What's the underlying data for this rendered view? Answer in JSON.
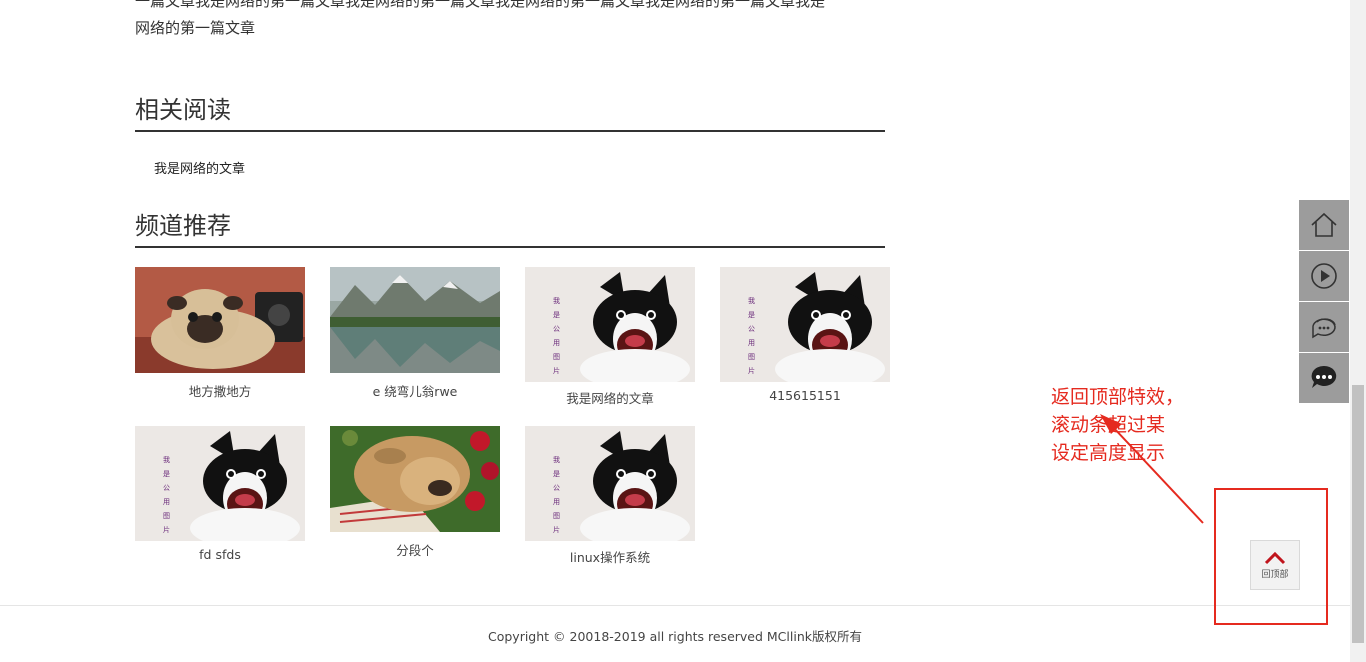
{
  "article": {
    "tail_line1": "一篇文章我是网络的第一篇文章我是网络的第一篇文章我是网络的第一篇文章我是网络的第一篇文章我是",
    "tail_line2": "网络的第一篇文章"
  },
  "related": {
    "title": "相关阅读",
    "items": [
      "我是网络的文章"
    ]
  },
  "channel": {
    "title": "频道推荐",
    "cards": [
      {
        "caption": "地方撒地方",
        "image": "pug"
      },
      {
        "caption": "e 绕弯儿翁rwe",
        "image": "lake"
      },
      {
        "caption": "我是网络的文章",
        "image": "dog-public"
      },
      {
        "caption": "415615151",
        "image": "dog-public"
      },
      {
        "caption": "fd sfds",
        "image": "dog-public"
      },
      {
        "caption": "分段个",
        "image": "bulldog"
      },
      {
        "caption": "linux操作系统",
        "image": "dog-public"
      }
    ],
    "public_image_text": [
      "我",
      "是",
      "公",
      "用",
      "图",
      "片"
    ]
  },
  "footer": {
    "copyright": "Copyright © 20018-2019 all rights reserved MCllink版权所有"
  },
  "side_tools": [
    {
      "icon": "home-icon"
    },
    {
      "icon": "play-icon"
    },
    {
      "icon": "chat-bubbles-icon"
    },
    {
      "icon": "message-icon"
    }
  ],
  "back_to_top": {
    "label": "回顶部",
    "icon": "chevron-up-icon"
  },
  "annotation": {
    "lines": [
      "返回顶部特效，",
      "滚动条超过某",
      "设定高度显示"
    ]
  },
  "colors": {
    "annotation": "#e52a1f",
    "tool_bg": "#9c9c9c",
    "back_top_chevron": "#c0141c"
  }
}
